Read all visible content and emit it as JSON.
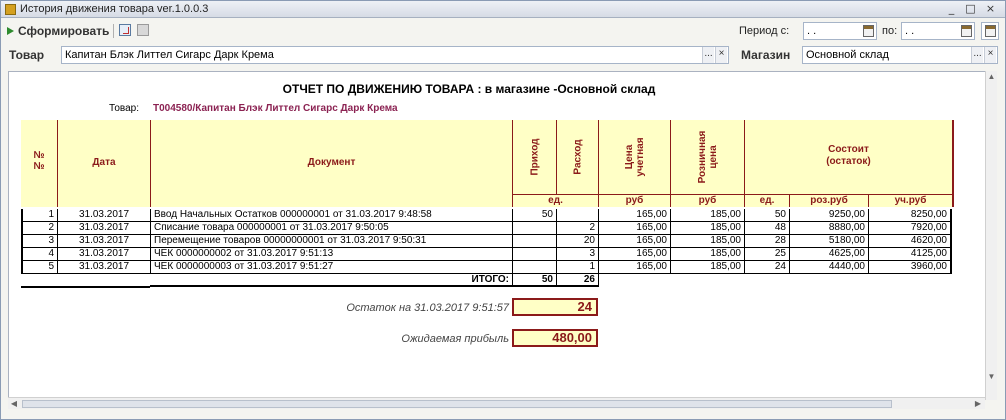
{
  "window": {
    "title": "История движения товара ver.1.0.0.3",
    "min_symbol": "_",
    "max_symbol": "□",
    "close_symbol": "×"
  },
  "toolbar": {
    "form_label": "Сформировать",
    "period_from_label": "Период с:",
    "period_from_value": ". .",
    "period_to_label": "по:",
    "period_to_value": ". ."
  },
  "filters": {
    "goods_label": "Товар",
    "goods_value": "Капитан Блэк Литтел Сигарс Дарк Крема",
    "store_label": "Магазин",
    "store_value": "Основной склад",
    "select_btn": "...",
    "clear_btn": "×"
  },
  "report": {
    "title": "ОТЧЕТ ПО ДВИЖЕНИЮ ТОВАРА : в магазине -Основной склад",
    "goods_label": "Товар:",
    "goods_value": "Т004580/Капитан Блэк Литтел Сигарс Дарк Крема",
    "headers": {
      "num": "№\n№",
      "date": "Дата",
      "document": "Документ",
      "income": "Приход",
      "expense": "Расход",
      "cost_price": "Цена\nучетная",
      "retail_price": "Розничная\nцена",
      "balance": "Состоит\n(остаток)",
      "unit_qty": "ед.",
      "unit_cost": "руб",
      "unit_retail": "руб",
      "bal_qty": "ед.",
      "bal_retail": "роз.руб",
      "bal_cost": "уч.руб"
    },
    "rows": [
      {
        "num": "1",
        "date": "31.03.2017",
        "doc": "Ввод Начальных Остатков 000000001 от 31.03.2017 9:48:58",
        "income": "50",
        "expense": "",
        "cost": "165,00",
        "retail": "185,00",
        "bal_qty": "50",
        "bal_retail": "9250,00",
        "bal_cost": "8250,00"
      },
      {
        "num": "2",
        "date": "31.03.2017",
        "doc": "Списание товара 000000001 от 31.03.2017 9:50:05",
        "income": "",
        "expense": "2",
        "cost": "165,00",
        "retail": "185,00",
        "bal_qty": "48",
        "bal_retail": "8880,00",
        "bal_cost": "7920,00"
      },
      {
        "num": "3",
        "date": "31.03.2017",
        "doc": "Перемещение товаров 00000000001 от 31.03.2017 9:50:31",
        "income": "",
        "expense": "20",
        "cost": "165,00",
        "retail": "185,00",
        "bal_qty": "28",
        "bal_retail": "5180,00",
        "bal_cost": "4620,00"
      },
      {
        "num": "4",
        "date": "31.03.2017",
        "doc": "ЧЕК 0000000002 от 31.03.2017 9:51:13",
        "income": "",
        "expense": "3",
        "cost": "165,00",
        "retail": "185,00",
        "bal_qty": "25",
        "bal_retail": "4625,00",
        "bal_cost": "4125,00"
      },
      {
        "num": "5",
        "date": "31.03.2017",
        "doc": "ЧЕК 0000000003 от 31.03.2017 9:51:27",
        "income": "",
        "expense": "1",
        "cost": "165,00",
        "retail": "185,00",
        "bal_qty": "24",
        "bal_retail": "4440,00",
        "bal_cost": "3960,00"
      }
    ],
    "total_label": "ИТОГО:",
    "total_income": "50",
    "total_expense": "26",
    "remainder_label": "Остаток на 31.03.2017 9:51:57",
    "remainder_value": "24",
    "profit_label": "Ожидаемая прибыль",
    "profit_value": "480,00"
  },
  "colors": {
    "header_bg": "#ffffc6",
    "header_text": "#8b1a1a",
    "goods_value": "#8b2252"
  }
}
